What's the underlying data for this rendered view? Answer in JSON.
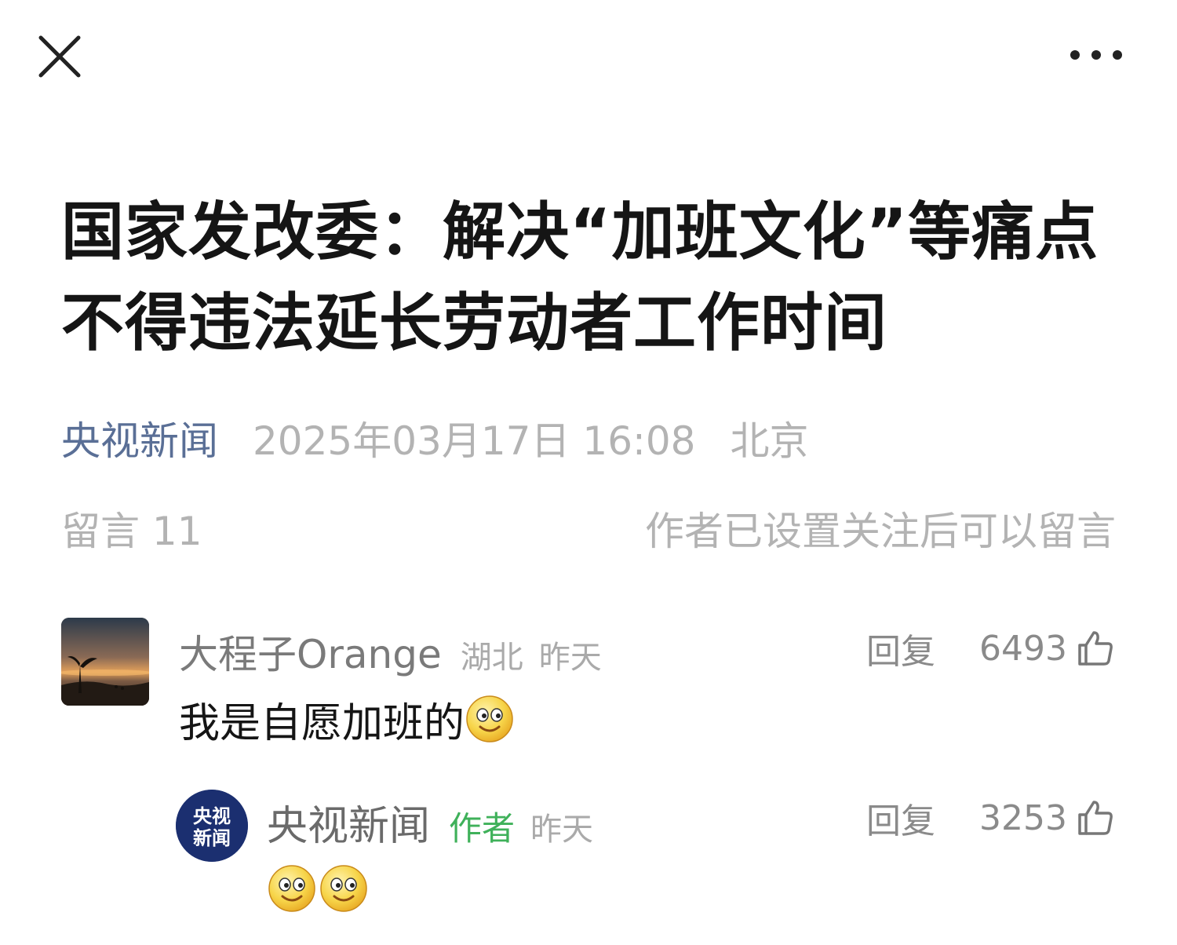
{
  "nav": {
    "close_icon": "close-icon",
    "more_icon": "more-dots-icon"
  },
  "article": {
    "title_line1": "国家发改委：解决“加班文化”等痛点",
    "title_line2": "不得违法延长劳动者工作时间",
    "source": "央视新闻",
    "publish_time": "2025年03月17日 16:08",
    "location": "北京"
  },
  "comments_section": {
    "count_label": "留言 11",
    "note": "作者已设置关注后可以留言"
  },
  "comments": [
    {
      "nickname": "大程子Orange",
      "region": "湖北",
      "time": "昨天",
      "reply_label": "回复",
      "likes": "6493",
      "text": "我是自愿加班的",
      "emoji": "smile-emoji"
    },
    {
      "nickname": "央视新闻",
      "author_tag": "作者",
      "time": "昨天",
      "reply_label": "回复",
      "likes": "3253",
      "avatar_text_1": "央视",
      "avatar_text_2": "新闻",
      "emoji": [
        "smile-emoji",
        "smile-emoji"
      ]
    }
  ],
  "colors": {
    "source_blue": "#5a6f96",
    "author_green": "#3fb15a",
    "logo_navy": "#1b2f70"
  }
}
